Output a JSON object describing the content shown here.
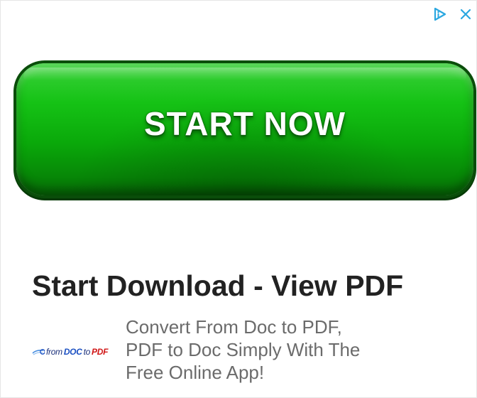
{
  "ad": {
    "controls": {
      "adchoices_icon": "adchoices-triangle-icon",
      "close_icon": "close-x-icon",
      "icon_color": "#2aa7e0"
    },
    "cta_button": {
      "label": "START NOW",
      "color": "#0aa90a"
    },
    "headline": "Start Download - View PDF",
    "logo": {
      "from": "from",
      "doc": "DOC",
      "to": "to",
      "pdf": "PDF"
    },
    "description_lines": [
      "Convert From Doc to PDF,",
      "PDF to Doc Simply With The",
      "Free Online App!"
    ]
  }
}
